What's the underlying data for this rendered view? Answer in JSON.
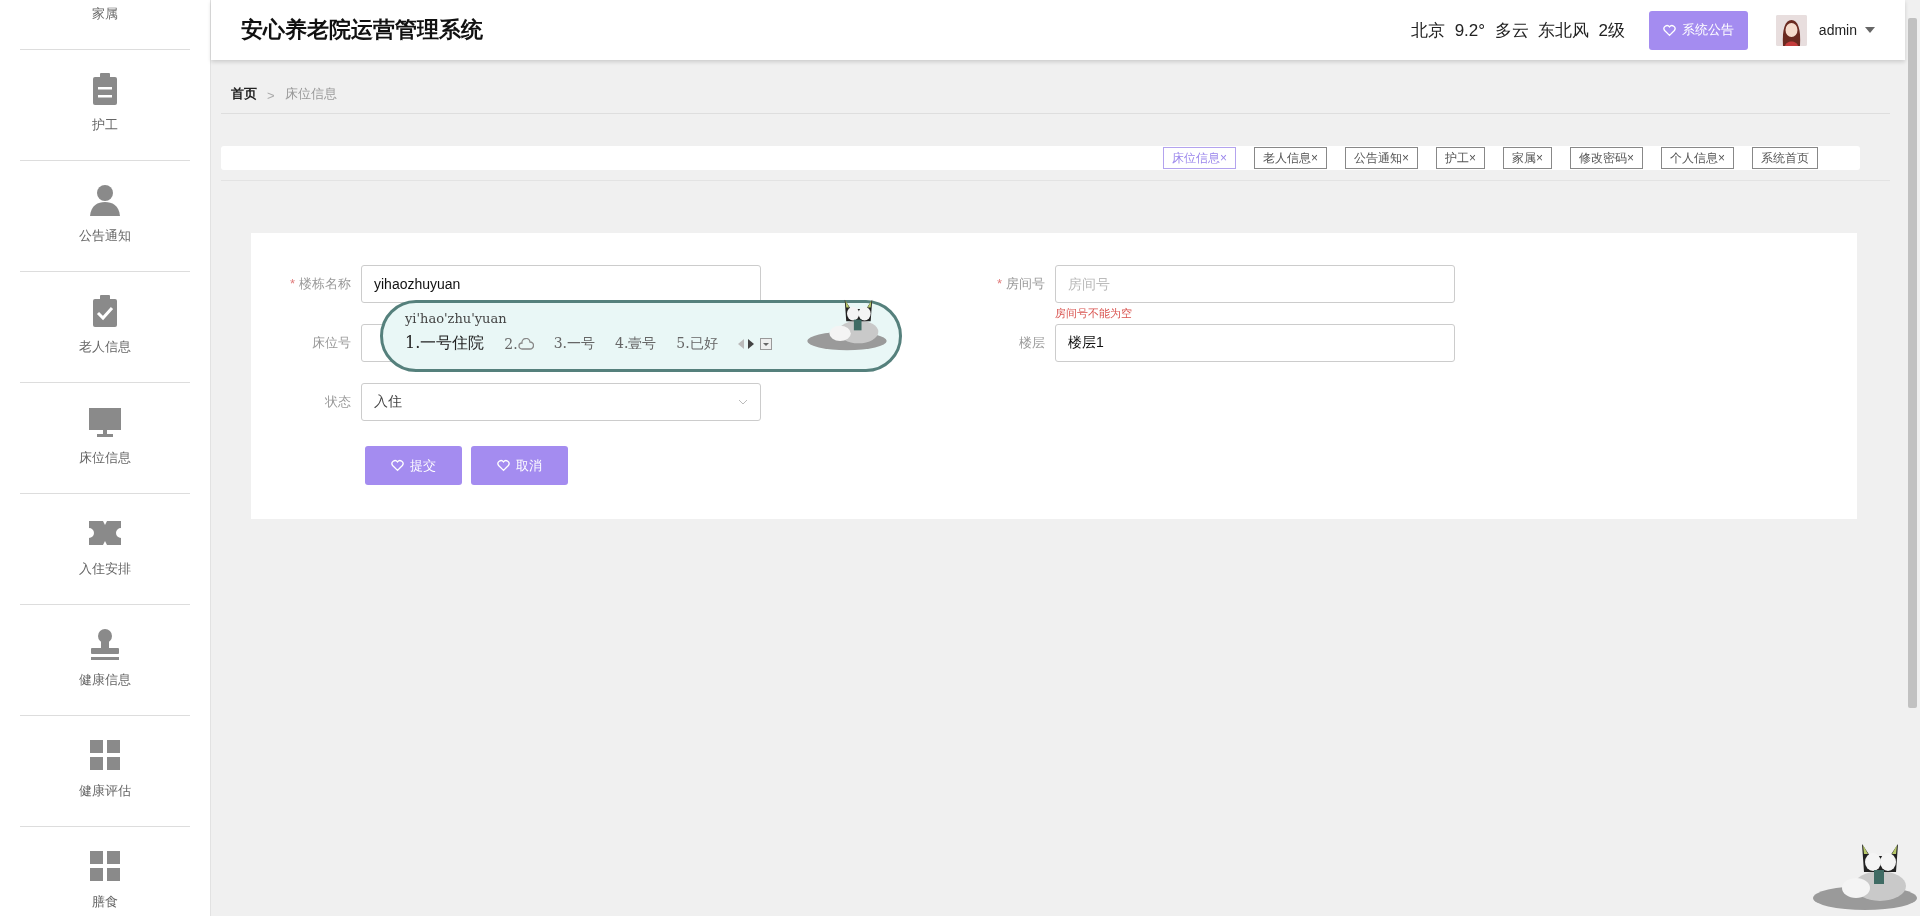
{
  "sidebar": {
    "items": [
      {
        "label": "家属",
        "kind": "hidden"
      },
      {
        "label": "护工",
        "kind": "clipboard"
      },
      {
        "label": "公告通知",
        "kind": "person"
      },
      {
        "label": "老人信息",
        "kind": "clipboard-check"
      },
      {
        "label": "床位信息",
        "kind": "monitor"
      },
      {
        "label": "入住安排",
        "kind": "ticket"
      },
      {
        "label": "健康信息",
        "kind": "stamp"
      },
      {
        "label": "健康评估",
        "kind": "grid"
      },
      {
        "label": "膳食",
        "kind": "grid"
      }
    ]
  },
  "header": {
    "title": "安心养老院运营管理系统",
    "weather": "北京  9.2°  多云  东北风  2级",
    "notice_button": "系统公告",
    "user": "admin"
  },
  "breadcrumb": {
    "separator": ">",
    "items": [
      {
        "label": "首页",
        "current": false
      },
      {
        "label": "床位信息",
        "current": true
      }
    ]
  },
  "tabs": [
    {
      "label": "床位信息",
      "close": "×",
      "selected": true
    },
    {
      "label": "老人信息",
      "close": "×",
      "selected": false
    },
    {
      "label": "公告通知",
      "close": "×",
      "selected": false
    },
    {
      "label": "护工",
      "close": "×",
      "selected": false
    },
    {
      "label": "家属",
      "close": "×",
      "selected": false
    },
    {
      "label": "修改密码",
      "close": "×",
      "selected": false
    },
    {
      "label": "个人信息",
      "close": "×",
      "selected": false
    },
    {
      "label": "系统首页",
      "selected": false
    }
  ],
  "form": {
    "fields": [
      {
        "kind": "input",
        "label": "楼栋名称",
        "required_mark": "*",
        "value": "yihaozhuyuan"
      },
      {
        "kind": "input",
        "label": "房间号",
        "required_mark": "*",
        "placeholder": "房间号",
        "error": "房间号不能为空"
      },
      {
        "kind": "input",
        "label": "床位号"
      },
      {
        "kind": "input",
        "label": "楼层",
        "value": "楼层1"
      },
      {
        "kind": "select",
        "label": "状态",
        "value": "入住"
      }
    ],
    "buttons": [
      "提交",
      "取消"
    ]
  },
  "ime": {
    "composition": "yi'hao'zhu'yuan",
    "candidates": [
      {
        "kind": "text",
        "num": "1.",
        "text": "一号住院",
        "selected": true
      },
      {
        "kind": "cloud",
        "num": "2.",
        "selected": false
      },
      {
        "kind": "text",
        "num": "3.",
        "text": "一号",
        "selected": false
      },
      {
        "kind": "text",
        "num": "4.",
        "text": "壹号",
        "selected": false
      },
      {
        "kind": "text",
        "num": "5.",
        "text": "已好",
        "selected": false
      }
    ]
  }
}
